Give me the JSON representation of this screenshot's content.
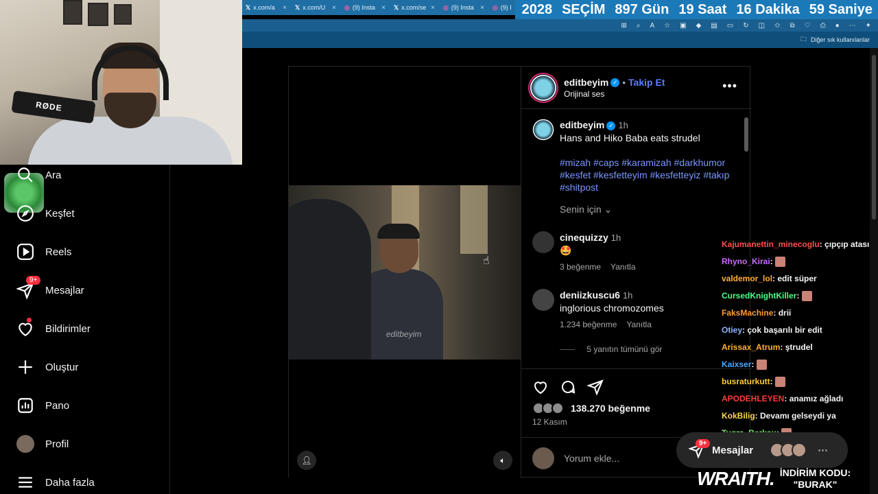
{
  "browser": {
    "tabs": [
      {
        "icon": "x",
        "title": "x.com/a"
      },
      {
        "icon": "x",
        "title": "x.com/U"
      },
      {
        "icon": "instagram",
        "title": "(9) Insta"
      },
      {
        "icon": "x",
        "title": "x.com/se"
      },
      {
        "icon": "instagram",
        "title": "(9) Insta"
      },
      {
        "icon": "instagram",
        "title": "(9) I"
      }
    ],
    "bookmark": "Diğer sık kullanılanlar"
  },
  "countdown": {
    "year": "2028",
    "label": "SEÇİM",
    "days": "897 Gün",
    "hours": "19 Saat",
    "minutes": "16 Dakika",
    "seconds": "59 Saniye"
  },
  "webcam": {
    "mic_brand": "RØDE"
  },
  "nav": [
    {
      "label": "Ara",
      "icon": "search-icon"
    },
    {
      "label": "Keşfet",
      "icon": "compass-icon"
    },
    {
      "label": "Reels",
      "icon": "reels-icon"
    },
    {
      "label": "Mesajlar",
      "icon": "messenger-icon",
      "badge": "9+"
    },
    {
      "label": "Bildirimler",
      "icon": "heart-icon"
    },
    {
      "label": "Oluştur",
      "icon": "plus-icon"
    },
    {
      "label": "Pano",
      "icon": "dashboard-icon"
    },
    {
      "label": "Profil",
      "icon": "avatar"
    },
    {
      "label": "Daha fazla",
      "icon": "menu-icon"
    }
  ],
  "post": {
    "username": "editbeyim",
    "follow_label": "Takip Et",
    "audio": "Orijinal ses",
    "video_watermark": "editbeyim",
    "caption": {
      "username": "editbeyim",
      "time": "1h",
      "text": "Hans and Hiko Baba eats strudel",
      "hashtags": "#mizah #caps #karamizah #darkhumor #kesfet #kesfetteyim #kesfetteyiz #takıp #shitpost"
    },
    "sort_label": "Senin için",
    "comments": [
      {
        "username": "cinequizzy",
        "time": "1h",
        "text": "🤩",
        "likes": "3 beğenme",
        "reply": "Yanıtla"
      },
      {
        "username": "deniizkuscu6",
        "time": "1h",
        "text": "inglorious chromozomes",
        "likes": "1.234 beğenme",
        "reply": "Yanıtla",
        "view_replies": "5 yanıtın tümünü gör"
      }
    ],
    "like_count": "138.270 beğenme",
    "date": "12 Kasım",
    "comment_placeholder": "Yorum ekle..."
  },
  "chat": [
    {
      "user": "Kajumanettin_minecoglu",
      "color": "#ff4d4d",
      "msg": "çıpçıp atasım kalmadı"
    },
    {
      "user": "Rhyno_Kirai",
      "color": "#c86bff",
      "msg": "",
      "emote": true
    },
    {
      "user": "valdemor_lol",
      "color": "#ffae42",
      "msg": "edit süper"
    },
    {
      "user": "CursedKnightKiller",
      "color": "#4dff88",
      "msg": "",
      "emote": true
    },
    {
      "user": "FaksMachine",
      "color": "#ff9c3a",
      "msg": "drii"
    },
    {
      "user": "Otiey",
      "color": "#8fb4ff",
      "msg": "çok başarılı bir edit"
    },
    {
      "user": "Arissax_Atrum",
      "color": "#ffb02e",
      "msg": "ştrudel"
    },
    {
      "user": "Kaixser",
      "color": "#4da6ff",
      "msg": "",
      "emote": true
    },
    {
      "user": "busraturkutt",
      "color": "#ffcc33",
      "msg": "",
      "emote": true
    },
    {
      "user": "APODEHLEYEN",
      "color": "#ff3b3b",
      "msg": "anamız ağladı"
    },
    {
      "user": "KokBilig",
      "color": "#ffd84d",
      "msg": "Devamı gelseydi ya"
    },
    {
      "user": "Tugra_Berksu",
      "color": "#7ae06b",
      "msg": "",
      "emote": true
    }
  ],
  "dm_pill": {
    "label": "Mesajlar",
    "badge": "9+"
  },
  "sponsor": {
    "brand": "WRAITH.",
    "promo_line1": "İNDİRİM KODU:",
    "promo_line2": "\"BURAK\""
  },
  "colors": {
    "accent": "#0095f6",
    "follow": "#5f7dff",
    "hashtag": "#7b97ff",
    "notification": "#ff3040",
    "chrome": "#1c79b8"
  }
}
